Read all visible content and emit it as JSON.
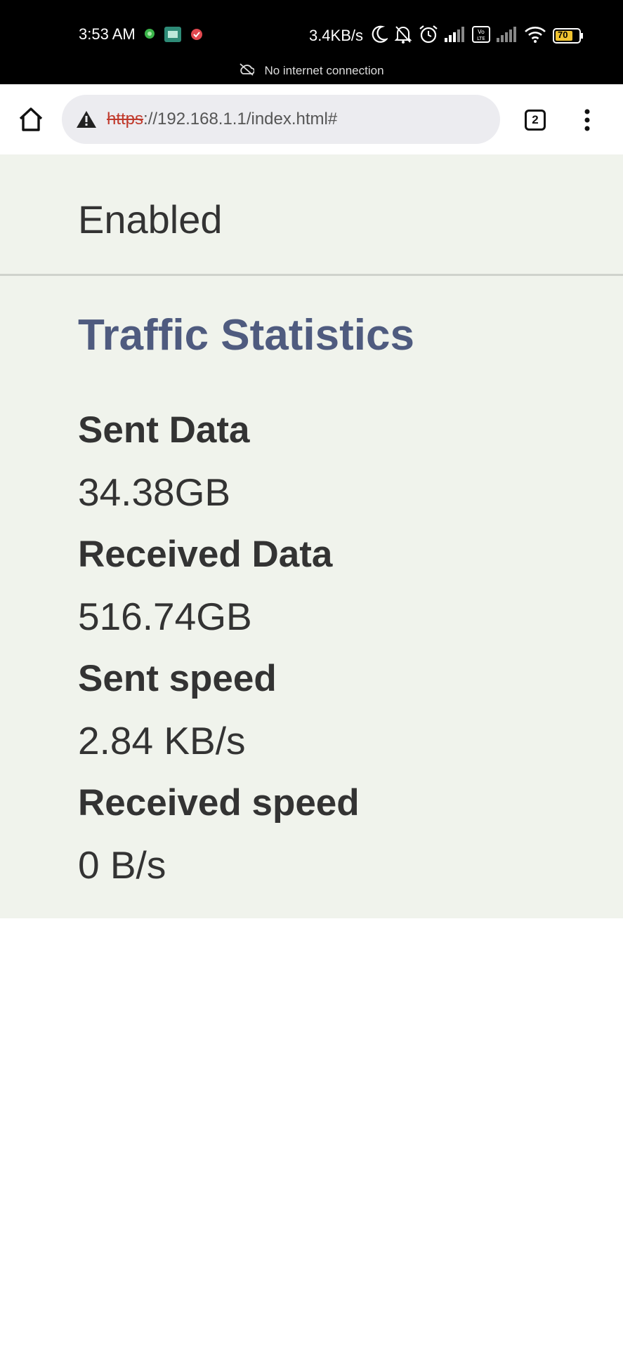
{
  "status_bar": {
    "time": "3:53 AM",
    "net_speed": "3.4KB/s",
    "battery": "70",
    "offline_message": "No internet connection",
    "icons": [
      "green-dot-icon",
      "app-notification-icon",
      "red-check-icon",
      "moon-icon",
      "bell-off-icon",
      "alarm-icon",
      "signal-icon",
      "volte-icon",
      "signal-icon",
      "wifi-icon",
      "battery-icon",
      "cloud-off-icon"
    ]
  },
  "browser": {
    "url_scheme": "https",
    "url_rest": "://192.168.1.1/index.html#",
    "tab_count": "2",
    "icons": [
      "home-icon",
      "warning-icon",
      "tabs-icon",
      "more-vert-icon"
    ]
  },
  "page": {
    "enabled_value": "Enabled",
    "section_title": "Traffic Statistics",
    "stats": [
      {
        "label": "Sent Data",
        "value": "34.38GB"
      },
      {
        "label": "Received Data",
        "value": "516.74GB"
      },
      {
        "label": "Sent speed",
        "value": "2.84 KB/s"
      },
      {
        "label": "Received speed",
        "value": "0 B/s"
      }
    ]
  },
  "colors": {
    "status_bar_bg": "#000000",
    "content_bg": "#f0f3ec",
    "title_color": "#4f5b7f",
    "text_color": "#333333",
    "url_scheme_color": "#c0392b"
  }
}
